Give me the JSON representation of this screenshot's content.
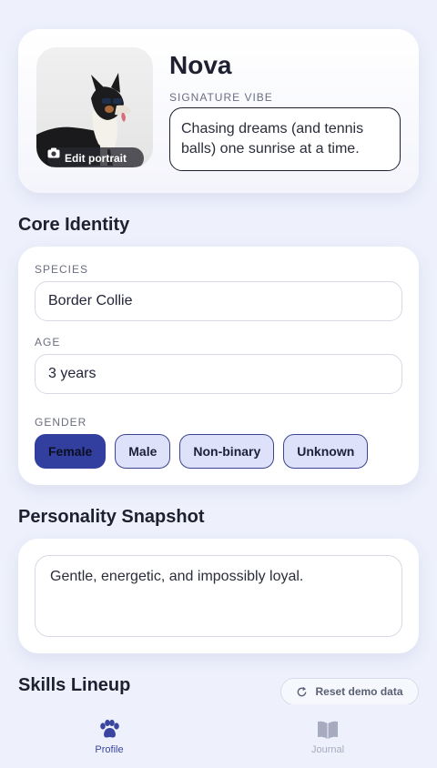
{
  "profile": {
    "name": "Nova",
    "edit_portrait_label": "Edit portrait",
    "vibe_label": "SIGNATURE VIBE",
    "vibe_text": "Chasing dreams (and tennis balls) one sunrise at a time."
  },
  "core_identity": {
    "title": "Core Identity",
    "species_label": "SPECIES",
    "species_value": "Border Collie",
    "age_label": "AGE",
    "age_value": "3 years",
    "gender_label": "GENDER",
    "gender_options": [
      "Female",
      "Male",
      "Non-binary",
      "Unknown"
    ],
    "gender_selected": "Female"
  },
  "personality": {
    "title": "Personality Snapshot",
    "text": "Gentle, energetic, and impossibly loyal."
  },
  "skills": {
    "title": "Skills Lineup",
    "reset_label": "Reset demo data"
  },
  "nav": {
    "items": [
      {
        "label": "Profile",
        "icon": "paw-icon",
        "active": true
      },
      {
        "label": "Journal",
        "icon": "book-icon",
        "active": false
      }
    ]
  },
  "colors": {
    "background": "#eef1fc",
    "accent": "#323f9e",
    "chip_bg": "#dde1fa",
    "nav_active": "#3a45a0",
    "nav_inactive": "#a7abbf"
  }
}
